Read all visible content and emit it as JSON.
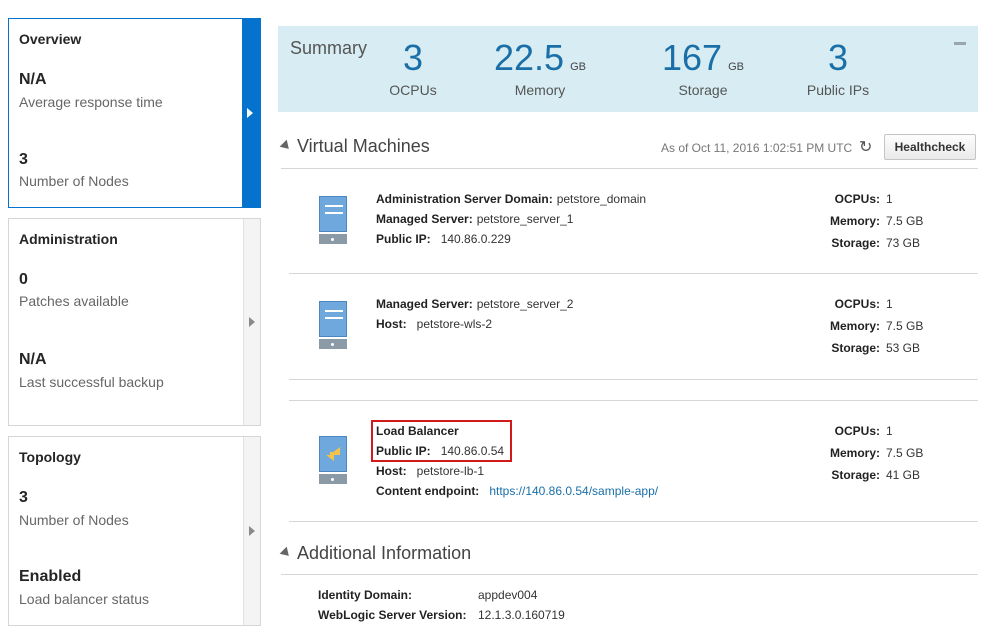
{
  "left_panels": {
    "overview": {
      "title": "Overview",
      "metric1_value": "N/A",
      "metric1_label": "Average response time",
      "metric2_value": "3",
      "metric2_label": "Number of Nodes"
    },
    "administration": {
      "title": "Administration",
      "metric1_value": "0",
      "metric1_label": "Patches available",
      "metric2_value": "N/A",
      "metric2_label": "Last successful backup"
    },
    "topology": {
      "title": "Topology",
      "metric1_value": "3",
      "metric1_label": "Number of Nodes",
      "metric2_value": "Enabled",
      "metric2_label": "Load balancer status"
    }
  },
  "summary": {
    "title": "Summary",
    "items": [
      {
        "value": "3",
        "unit": "",
        "label": "OCPUs"
      },
      {
        "value": "22.5",
        "unit": "GB",
        "label": "Memory"
      },
      {
        "value": "167",
        "unit": "GB",
        "label": "Storage"
      },
      {
        "value": "3",
        "unit": "",
        "label": "Public IPs"
      }
    ]
  },
  "virtual_machines": {
    "title": "Virtual Machines",
    "as_of": "As of Oct 11, 2016 1:02:51 PM UTC",
    "healthcheck_label": "Healthcheck",
    "vms": [
      {
        "fields": [
          {
            "k": "Administration Server Domain:",
            "v": "petstore_domain"
          },
          {
            "k": "Managed Server:",
            "v": "petstore_server_1"
          },
          {
            "k": "Public IP:",
            "v": "140.86.0.229"
          }
        ],
        "ocpus": "1",
        "memory": "7.5 GB",
        "storage": "73 GB"
      },
      {
        "fields": [
          {
            "k": "Managed Server:",
            "v": "petstore_server_2"
          },
          {
            "k": "Host:",
            "v": "petstore-wls-2"
          }
        ],
        "ocpus": "1",
        "memory": "7.5 GB",
        "storage": "53 GB"
      },
      {
        "fields": [
          {
            "k": "Load Balancer",
            "v": ""
          },
          {
            "k": "Public IP:",
            "v": "140.86.0.54"
          },
          {
            "k": "Host:",
            "v": "petstore-lb-1"
          },
          {
            "k": "Content endpoint:",
            "v": "https://140.86.0.54/sample-app/"
          }
        ],
        "ocpus": "1",
        "memory": "7.5 GB",
        "storage": "41 GB"
      }
    ],
    "labels": {
      "ocpus": "OCPUs:",
      "memory": "Memory:",
      "storage": "Storage:"
    }
  },
  "additional_info": {
    "title": "Additional Information",
    "rows": [
      {
        "k": "Identity Domain:",
        "v": "appdev004"
      },
      {
        "k": "WebLogic Server Version:",
        "v": "12.1.3.0.160719"
      }
    ]
  },
  "colors": {
    "accent": "#0572ce",
    "summary_bg": "#d7edf3",
    "summary_number": "#1a6fa8",
    "highlight_box": "#d11a1a",
    "link": "#1a6fa8"
  }
}
